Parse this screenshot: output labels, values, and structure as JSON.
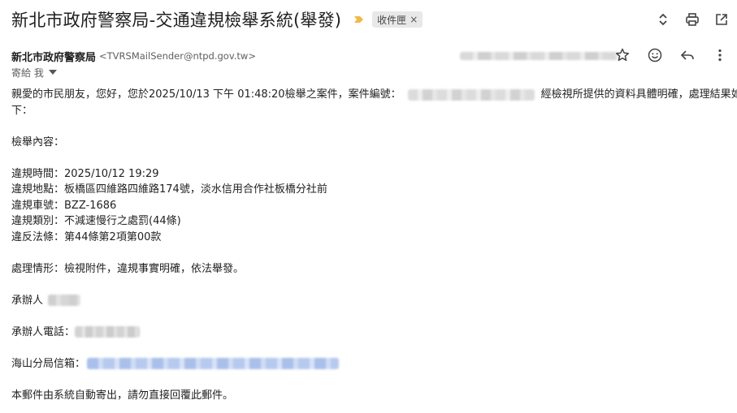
{
  "header": {
    "subject": "新北市政府警察局-交通違規檢舉系統(舉發)",
    "label_chip": "收件匣",
    "label_chip_close": "×",
    "icons": [
      "expand-collapse-icon",
      "print-icon",
      "open-in-new-window-icon"
    ]
  },
  "sender": {
    "name": "新北市政府警察局",
    "email": "<TVRSMailSender@ntpd.gov.tw>",
    "icons": [
      "star-icon",
      "emoji-reaction-icon",
      "reply-icon",
      "more-vert-icon"
    ]
  },
  "recipient": {
    "to_label": "寄給 我"
  },
  "body": {
    "greeting_prefix": "親愛的市民朋友，您好，您於2025/10/13 下午 01:48:20檢舉之案件，案件編號：",
    "greeting_suffix": "經檢視所提供的資料具體明確，處理結果如",
    "greeting_line2": "下：",
    "content_heading": "檢舉內容：",
    "violation_time": "違規時間：2025/10/12 19:29",
    "violation_location": "違規地點：板橋區四維路四維路174號，淡水信用合作社板橋分社前",
    "violation_plate": "違規車號：BZZ-1686",
    "violation_type": "違規類別：不減速慢行之處罰(44條)",
    "violation_law": "違反法條：第44條第2項第00款",
    "handling": "處理情形：檢視附件，違規事實明確，依法舉發。",
    "handler_label": "承辦人",
    "handler_phone_label": "承辦人電話：",
    "branch_email_label": "海山分局信箱：",
    "footer_note": "本郵件由系統自動寄出，請勿直接回覆此郵件。"
  },
  "colors": {
    "label_arrow": "#f2b84b",
    "chip_bg": "#e8e8e8",
    "text": "#1f1f1f",
    "secondary_text": "#5e5e5e"
  }
}
